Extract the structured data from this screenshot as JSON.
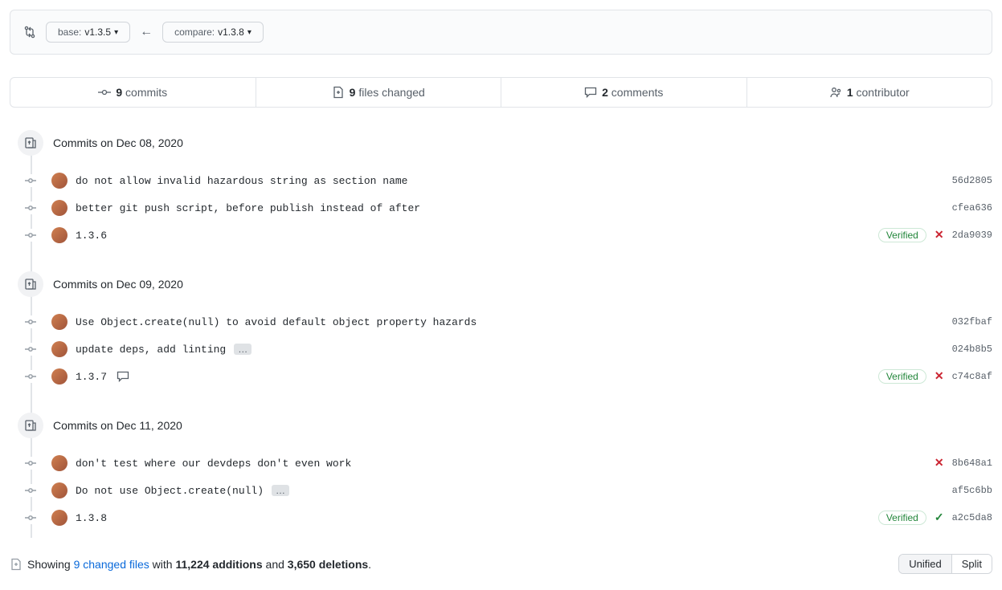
{
  "compare": {
    "base_prefix": "base:",
    "base_ref": "v1.3.5",
    "compare_prefix": "compare:",
    "compare_ref": "v1.3.8"
  },
  "tabs": {
    "commits_count": "9",
    "commits_label": "commits",
    "files_count": "9",
    "files_label": "files changed",
    "comments_count": "2",
    "comments_label": "comments",
    "contributors_count": "1",
    "contributors_label": "contributor"
  },
  "groups": [
    {
      "header": "Commits on Dec 08, 2020",
      "commits": [
        {
          "msg": "do not allow invalid hazardous string as section name",
          "sha": "56d2805",
          "verified": false,
          "status": "",
          "has_ellipsis": false,
          "has_comment": false
        },
        {
          "msg": "better git push script, before publish instead of after",
          "sha": "cfea636",
          "verified": false,
          "status": "",
          "has_ellipsis": false,
          "has_comment": false
        },
        {
          "msg": "1.3.6",
          "sha": "2da9039",
          "verified": true,
          "status": "fail",
          "has_ellipsis": false,
          "has_comment": false
        }
      ]
    },
    {
      "header": "Commits on Dec 09, 2020",
      "commits": [
        {
          "msg": "Use Object.create(null) to avoid default object property hazards",
          "sha": "032fbaf",
          "verified": false,
          "status": "",
          "has_ellipsis": false,
          "has_comment": false
        },
        {
          "msg": "update deps, add linting",
          "sha": "024b8b5",
          "verified": false,
          "status": "",
          "has_ellipsis": true,
          "has_comment": false
        },
        {
          "msg": "1.3.7",
          "sha": "c74c8af",
          "verified": true,
          "status": "fail",
          "has_ellipsis": false,
          "has_comment": true
        }
      ]
    },
    {
      "header": "Commits on Dec 11, 2020",
      "commits": [
        {
          "msg": "don't test where our devdeps don't even work",
          "sha": "8b648a1",
          "verified": false,
          "status": "fail",
          "has_ellipsis": false,
          "has_comment": false
        },
        {
          "msg": "Do not use Object.create(null)",
          "sha": "af5c6bb",
          "verified": false,
          "status": "",
          "has_ellipsis": true,
          "has_comment": false
        },
        {
          "msg": "1.3.8",
          "sha": "a2c5da8",
          "verified": true,
          "status": "pass",
          "has_ellipsis": false,
          "has_comment": false
        }
      ]
    }
  ],
  "footer": {
    "showing": "Showing ",
    "changed_files": "9 changed files",
    "with": " with ",
    "additions": "11,224 additions",
    "and": " and ",
    "deletions": "3,650 deletions",
    "period": ".",
    "unified": "Unified",
    "split": "Split"
  },
  "labels": {
    "verified": "Verified",
    "ellipsis": "…"
  }
}
